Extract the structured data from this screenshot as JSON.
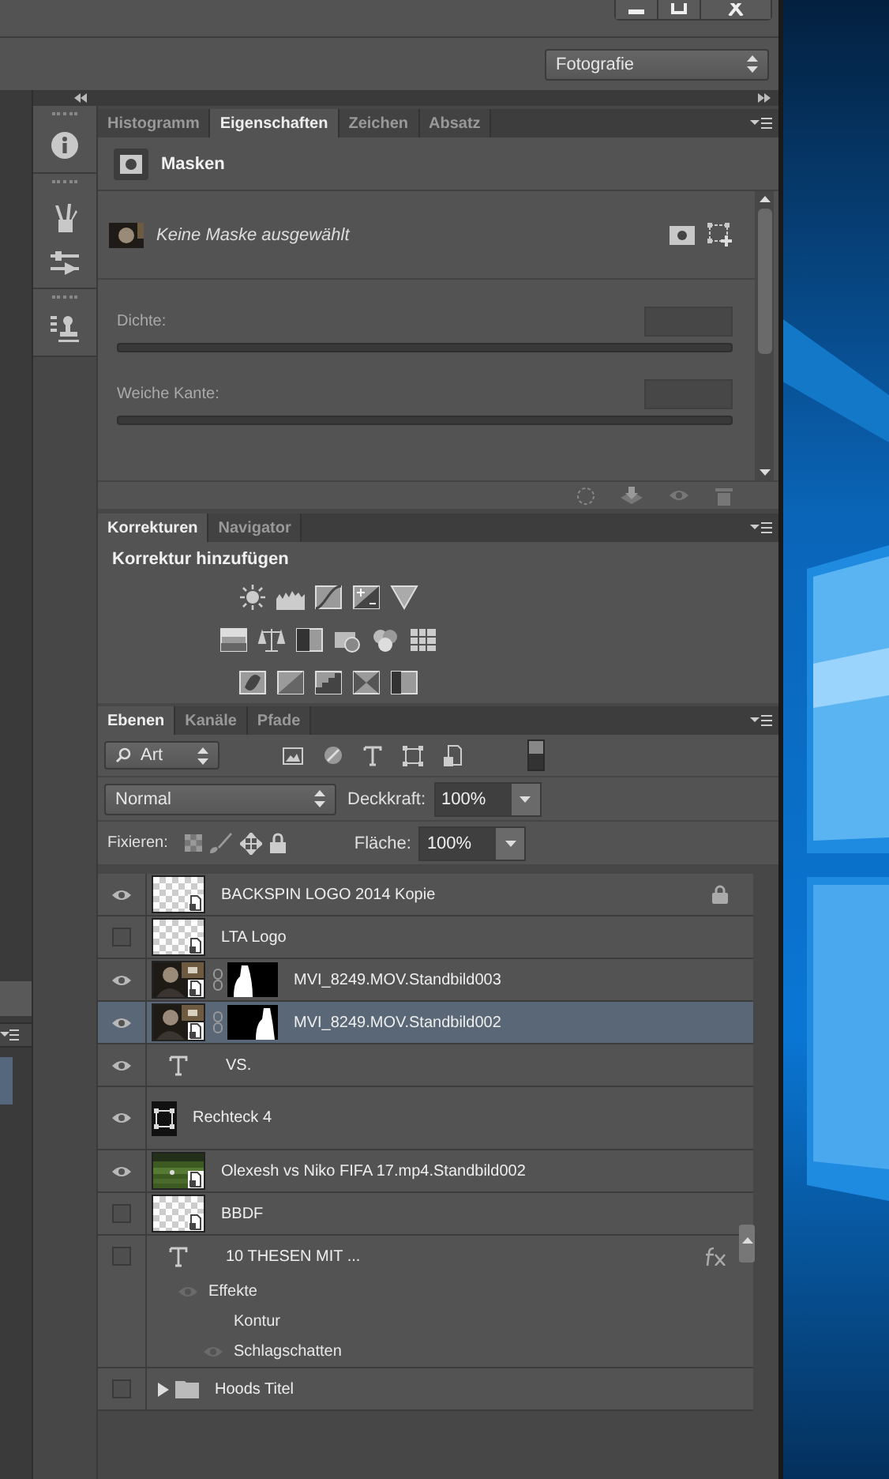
{
  "workspace": {
    "value": "Fotografie"
  },
  "properties": {
    "tabs": [
      {
        "label": "Histogramm",
        "selected": false
      },
      {
        "label": "Eigenschaften",
        "selected": true
      },
      {
        "label": "Zeichen",
        "selected": false
      },
      {
        "label": "Absatz",
        "selected": false
      }
    ],
    "title": "Masken",
    "mask_status": "Keine Maske ausgewählt",
    "fields": [
      {
        "label": "Dichte:"
      },
      {
        "label": "Weiche Kante:"
      }
    ]
  },
  "adjustments": {
    "tabs": [
      {
        "label": "Korrekturen",
        "selected": true
      },
      {
        "label": "Navigator",
        "selected": false
      }
    ],
    "title": "Korrektur hinzufügen"
  },
  "layers": {
    "tabs": [
      {
        "label": "Ebenen",
        "selected": true
      },
      {
        "label": "Kanäle",
        "selected": false
      },
      {
        "label": "Pfade",
        "selected": false
      }
    ],
    "filter": "Art",
    "blend_mode": "Normal",
    "opacity_label": "Deckkraft:",
    "opacity": "100%",
    "lock_label": "Fixieren:",
    "fill_label": "Fläche:",
    "fill": "100%",
    "items": [
      {
        "name": "BACKSPIN LOGO 2014 Kopie",
        "kind": "blank",
        "mask": false,
        "visible": true,
        "selected": false,
        "locked": true,
        "fx": false
      },
      {
        "name": "LTA Logo",
        "kind": "blank",
        "mask": false,
        "visible": false,
        "selected": false,
        "locked": false,
        "fx": false
      },
      {
        "name": "MVI_8249.MOV.Standbild003",
        "mask": true,
        "visible": true,
        "selected": false,
        "locked": false,
        "fx": false
      },
      {
        "name": "MVI_8249.MOV.Standbild002",
        "mask": true,
        "visible": true,
        "selected": true,
        "locked": false,
        "fx": false
      },
      {
        "name": "VS.",
        "kind": "text",
        "visible": true,
        "selected": false,
        "locked": false,
        "fx": false
      },
      {
        "name": "Rechteck 4",
        "kind": "shape",
        "visible": true,
        "selected": false,
        "locked": false,
        "fx": false
      },
      {
        "name": "Olexesh vs Niko FIFA 17.mp4.Standbild002",
        "kind": "footage",
        "mask": false,
        "visible": true,
        "selected": false,
        "locked": false,
        "fx": false
      },
      {
        "name": "BBDF",
        "kind": "blank",
        "mask": false,
        "visible": false,
        "selected": false,
        "locked": false,
        "fx": false
      },
      {
        "name": "10 THESEN MIT ...",
        "kind": "text",
        "visible": false,
        "selected": false,
        "locked": false,
        "fx": true,
        "effects": [
          {
            "label": "Effekte",
            "visible": true,
            "children": [
              {
                "label": "Kontur",
                "visible": false
              },
              {
                "label": "Schlagschatten",
                "visible": true
              }
            ]
          }
        ]
      },
      {
        "name": "Hoods Titel",
        "kind": "group",
        "expanded": false,
        "visible": false,
        "selected": false,
        "locked": false,
        "fx": false
      }
    ]
  }
}
